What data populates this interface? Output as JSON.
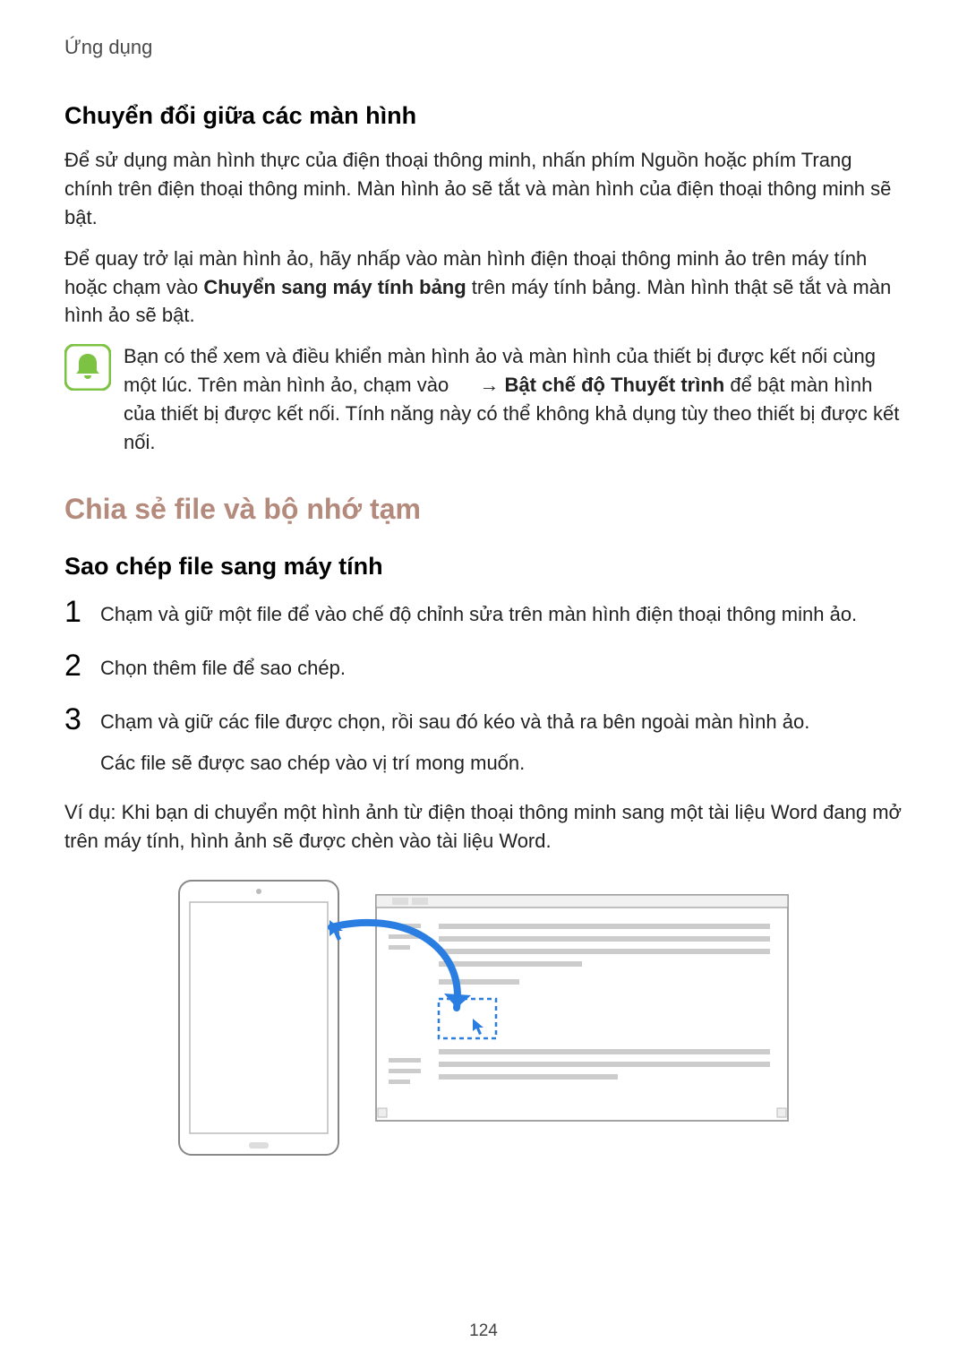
{
  "header": "Ứng dụng",
  "section1": {
    "title": "Chuyển đổi giữa các màn hình",
    "p1": "Để sử dụng màn hình thực của điện thoại thông minh, nhấn phím Nguồn hoặc phím Trang chính trên điện thoại thông minh. Màn hình ảo sẽ tắt và màn hình của điện thoại thông minh sẽ bật.",
    "p2_a": "Để quay trở lại màn hình ảo, hãy nhấp vào màn hình điện thoại thông minh ảo trên máy tính hoặc chạm vào ",
    "p2_bold": "Chuyển sang máy tính bảng",
    "p2_b": " trên máy tính bảng. Màn hình thật sẽ tắt và màn hình ảo sẽ bật.",
    "note_a": "Bạn có thể xem và điều khiển màn hình ảo và màn hình của thiết bị được kết nối cùng một lúc. Trên màn hình ảo, chạm vào   → ",
    "note_bold": "Bật chế độ Thuyết trình",
    "note_b": " để bật màn hình của thiết bị được kết nối. Tính năng này có thể không khả dụng tùy theo thiết bị được kết nối."
  },
  "section2": {
    "title": "Chia sẻ file và bộ nhớ tạm",
    "subtitle": "Sao chép file sang máy tính",
    "steps": [
      {
        "num": "1",
        "text": "Chạm và giữ một file để vào chế độ chỉnh sửa trên màn hình điện thoại thông minh ảo."
      },
      {
        "num": "2",
        "text": "Chọn thêm file để sao chép."
      },
      {
        "num": "3",
        "text": "Chạm và giữ các file được chọn, rồi sau đó kéo và thả ra bên ngoài màn hình ảo.",
        "sub": "Các file sẽ được sao chép vào vị trí mong muốn."
      }
    ],
    "example": "Ví dụ: Khi bạn di chuyển một hình ảnh từ điện thoại thông minh sang một tài liệu Word đang mở trên máy tính, hình ảnh sẽ được chèn vào tài liệu Word."
  },
  "pageNumber": "124"
}
